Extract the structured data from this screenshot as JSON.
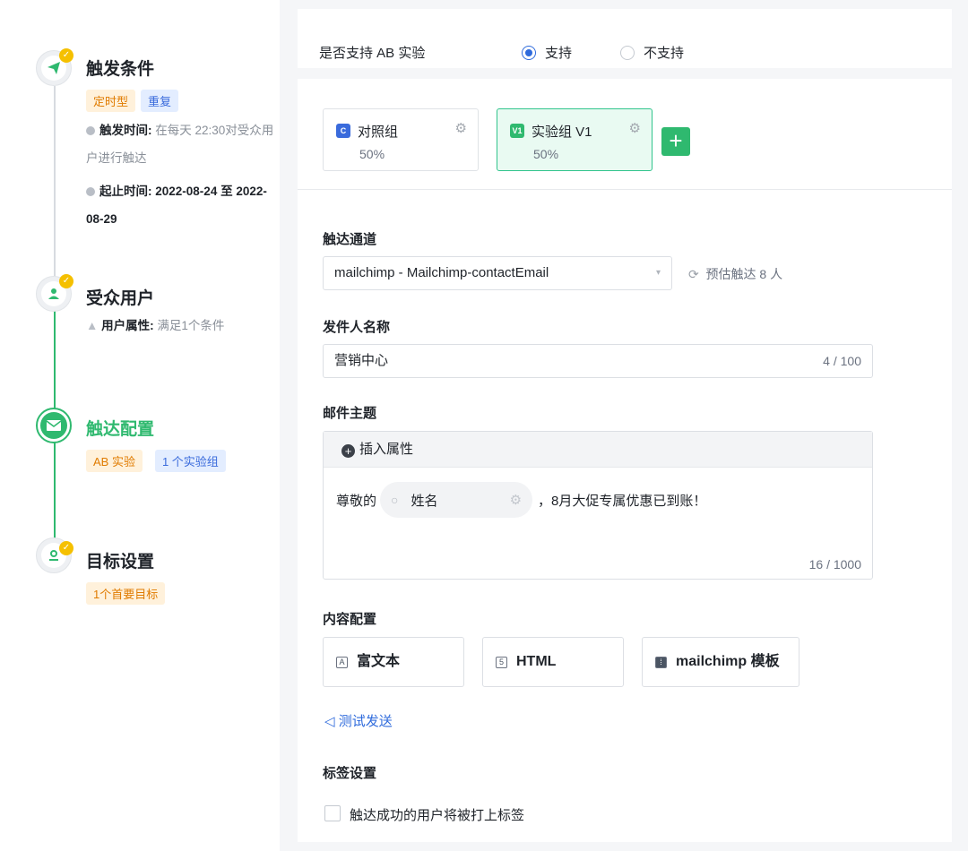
{
  "steps": [
    {
      "title": "触发条件",
      "tags": [
        "定时型",
        "重复"
      ],
      "meta": [
        {
          "label": "触发时间:",
          "value": "在每天 22:30对受众用户进行触达"
        },
        {
          "label": "起止时间:",
          "value": "2022-08-24 至 2022-08-29"
        }
      ],
      "icon": "paper-plane-icon"
    },
    {
      "title": "受众用户",
      "meta_label": "用户属性:",
      "meta_value": "满足1个条件",
      "icon": "user-icon"
    },
    {
      "title": "触达配置",
      "tags": [
        "AB 实验",
        "1 个实验组"
      ],
      "icon": "email-icon"
    },
    {
      "title": "目标设置",
      "tags": [
        "1个首要目标"
      ],
      "icon": "target-user-icon"
    }
  ],
  "ab": {
    "label": "是否支持 AB 实验",
    "option_yes": "支持",
    "option_no": "不支持",
    "selected": "支持"
  },
  "groups": [
    {
      "badge": "C",
      "name": "对照组",
      "percent": "50%",
      "color": "#3a6bdc"
    },
    {
      "badge": "V1",
      "name": "实验组 V1",
      "percent": "50%",
      "color": "#2fb96f"
    }
  ],
  "add_label": "+",
  "channel": {
    "label": "触达通道",
    "value": "mailchimp - Mailchimp-contactEmail",
    "estimate": "预估触达 8 人"
  },
  "sender": {
    "label": "发件人名称",
    "value": "营销中心",
    "counter": "4 / 100"
  },
  "subject": {
    "label": "邮件主题",
    "insert_label": "插入属性",
    "prefix": "尊敬的",
    "chip": "姓名",
    "suffix": "，8月大促专属优惠已到账！",
    "counter": "16 / 1000"
  },
  "content": {
    "label": "内容配置",
    "types": [
      "富文本",
      "HTML",
      "mailchimp 模板"
    ],
    "test_send": "测试发送"
  },
  "tag_settings": {
    "label": "标签设置",
    "checkbox_label": "触达成功的用户将被打上标签"
  },
  "colors": {
    "accent": "#2f6bdc",
    "success": "#2fb96f",
    "warning": "#f5c000"
  }
}
